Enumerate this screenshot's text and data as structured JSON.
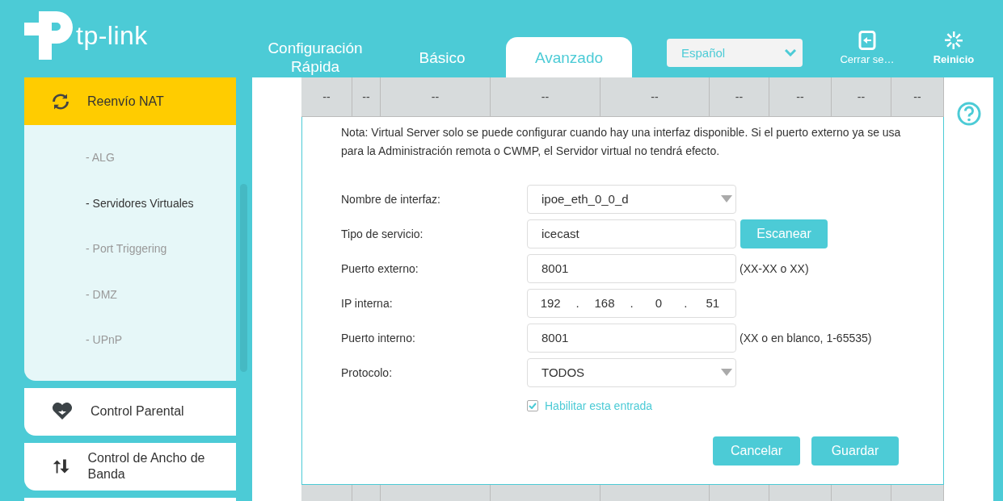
{
  "header": {
    "logo": "tp-link",
    "tabs": [
      {
        "label": "Configuración Rápida",
        "selected": false
      },
      {
        "label": "Básico",
        "selected": false
      },
      {
        "label": "Avanzado",
        "selected": true
      }
    ],
    "language": {
      "value": "Español"
    },
    "logout": "Cerrar se…",
    "reboot": "Reinicio"
  },
  "sidebar": {
    "items": [
      {
        "label": "Reenvío NAT",
        "selected": true,
        "expanded": true,
        "children": [
          {
            "label": "- ALG",
            "selected": false
          },
          {
            "label": "- Servidores Virtuales",
            "selected": true
          },
          {
            "label": "- Port Triggering",
            "selected": false
          },
          {
            "label": "- DMZ",
            "selected": false
          },
          {
            "label": "- UPnP",
            "selected": false
          }
        ]
      },
      {
        "label": "Control Parental",
        "selected": false,
        "expanded": false
      },
      {
        "label": "Control de Ancho de Banda",
        "selected": false,
        "expanded": false
      }
    ]
  },
  "table": {
    "row": [
      "--",
      "--",
      "--",
      "--",
      "--",
      "--",
      "--",
      "--",
      "--"
    ]
  },
  "form": {
    "note": "Nota: Virtual Server solo se puede configurar cuando hay una interfaz disponible. Si el puerto externo ya se usa para la Administración remota o CWMP, el Servidor virtual no tendrá efecto.",
    "fields": [
      {
        "kind": "select",
        "label": "Nombre de interfaz:",
        "value": "ipoe_eth_0_0_d"
      },
      {
        "kind": "text",
        "label": "Tipo de servicio:",
        "value": "icecast",
        "button": "Escanear"
      },
      {
        "kind": "text",
        "label": "Puerto externo:",
        "value": "8001",
        "hint": "(XX-XX o XX)"
      },
      {
        "kind": "ip",
        "label": "IP interna:",
        "parts": [
          "192",
          "168",
          "0",
          "51"
        ],
        "separator": "."
      },
      {
        "kind": "text",
        "label": "Puerto interno:",
        "value": "8001",
        "hint": "(XX o en blanco, 1-65535)"
      },
      {
        "kind": "select",
        "label": "Protocolo:",
        "value": "TODOS"
      }
    ],
    "enable": {
      "label": "Habilitar esta entrada",
      "checked": true
    },
    "buttons": [
      "Cancelar",
      "Guardar"
    ]
  }
}
